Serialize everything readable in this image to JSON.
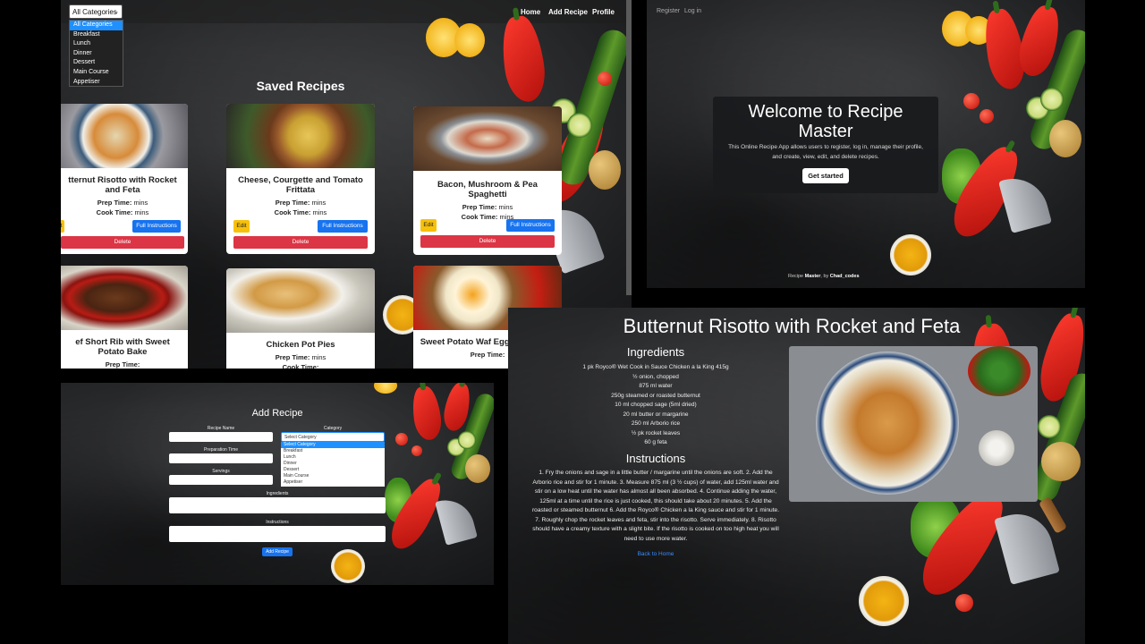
{
  "list_view": {
    "filter_selected": "All Categories",
    "filter_options": [
      "All Categories",
      "Breakfast",
      "Lunch",
      "Dinner",
      "Dessert",
      "Main Course",
      "Appetiser"
    ],
    "nav": [
      "Home",
      "Add Recipe",
      "Profile"
    ],
    "heading": "Saved Recipes",
    "edit_label": "Edit",
    "instructions_label": "Full Instructions",
    "delete_label": "Delete",
    "prep_label": "Prep Time:",
    "cook_label": "Cook Time:",
    "time_value": "mins",
    "recipes": [
      {
        "title": "tternut Risotto with Rocket and Feta"
      },
      {
        "title": "Cheese, Courgette and Tomato Frittata"
      },
      {
        "title": "Bacon, Mushroom & Pea Spaghetti"
      },
      {
        "title": "ef Short Rib with Sweet Potato Bake"
      },
      {
        "title": "Chicken Pot Pies"
      },
      {
        "title": "Sweet Potato Waf Egg, Bacon, an"
      }
    ]
  },
  "home_view": {
    "nav": [
      "Register",
      "Log in"
    ],
    "title": "Welcome to Recipe Master",
    "description": "This Online Recipe App allows users to register, log in, manage their profile, and create, view, edit, and delete recipes.",
    "cta": "Get started",
    "footer_prefix": "Recipe",
    "footer_brand": "Master",
    "footer_by": ", by",
    "footer_author": "Chad_codes"
  },
  "add_view": {
    "heading": "Add Recipe",
    "recipe_name_label": "Recipe Name",
    "category_label": "Category",
    "category_placeholder": "Select Category",
    "category_options": [
      "Select Category",
      "Breakfast",
      "Lunch",
      "Dinner",
      "Dessert",
      "Main Course",
      "Appetiser"
    ],
    "prep_label": "Preparation Time",
    "servings_label": "Servings",
    "ingredients_label": "Ingredients",
    "instructions_label": "Instructions",
    "submit": "Add Recipe"
  },
  "detail_view": {
    "title": "Butternut Risotto with Rocket and Feta",
    "ingredients_heading": "Ingredients",
    "ingredients": [
      "1 pk Royco® Wet Cook in Sauce Chicken a la King 415g",
      "½ onion, chopped",
      "875 ml water",
      "250g steamed or roasted butternut",
      "10 ml chopped sage (5ml dried)",
      "20 ml butter or margarine",
      "250 ml Arborio rice",
      "½ pk rocket leaves",
      "60 g feta"
    ],
    "instructions_heading": "Instructions",
    "instructions": "1. Fry the onions and sage in a little butter / margarine until the onions are soft. 2. Add the Arborio rice and stir for 1 minute. 3. Measure 875 ml (3 ½ cups) of water, add 125ml water and stir on a low heat until the water has almost all been absorbed. 4. Continue adding the water, 125ml at a time until the rice is just cooked, this should take about 20 minutes. 5. Add the roasted or steamed butternut 6. Add the Royco® Chicken a la King sauce and stir for 1 minute. 7. Roughly chop the rocket leaves and feta, stir into the risotto. Serve immediately. 8. Risotto should have a creamy texture with a slight bite. If the risotto is cooked on too high heat you will need to use more water.",
    "back_link": "Back to Home"
  }
}
